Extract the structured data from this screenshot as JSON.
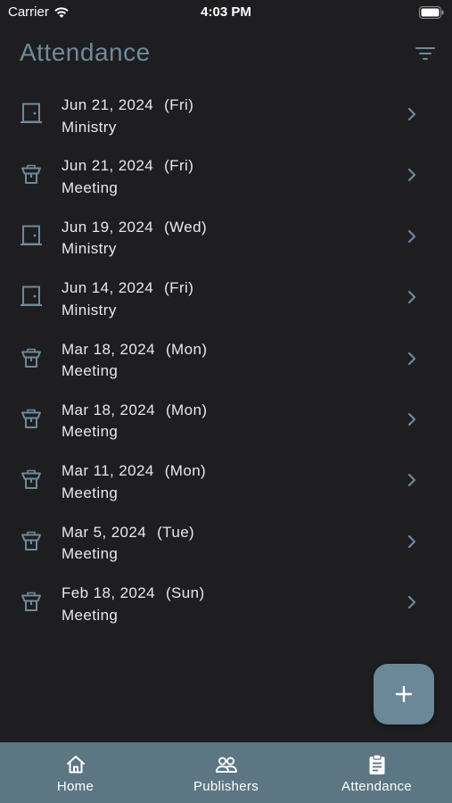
{
  "status_bar": {
    "carrier": "Carrier",
    "time": "4:03 PM"
  },
  "header": {
    "title": "Attendance",
    "filter_icon": "filter-icon"
  },
  "colors": {
    "accent": "#6b8898",
    "title": "#6f8a99",
    "background": "#1e1e20",
    "tabbar": "#5c7683"
  },
  "records": [
    {
      "date": "Jun 21, 2024",
      "day": "(Fri)",
      "type": "Ministry",
      "icon": "door-icon"
    },
    {
      "date": "Jun 21, 2024",
      "day": "(Fri)",
      "type": "Meeting",
      "icon": "lectern-icon"
    },
    {
      "date": "Jun 19, 2024",
      "day": "(Wed)",
      "type": "Ministry",
      "icon": "door-icon"
    },
    {
      "date": "Jun 14, 2024",
      "day": "(Fri)",
      "type": "Ministry",
      "icon": "door-icon"
    },
    {
      "date": "Mar 18, 2024",
      "day": "(Mon)",
      "type": "Meeting",
      "icon": "lectern-icon"
    },
    {
      "date": "Mar 18, 2024",
      "day": "(Mon)",
      "type": "Meeting",
      "icon": "lectern-icon"
    },
    {
      "date": "Mar 11, 2024",
      "day": "(Mon)",
      "type": "Meeting",
      "icon": "lectern-icon"
    },
    {
      "date": "Mar 5, 2024",
      "day": "(Tue)",
      "type": "Meeting",
      "icon": "lectern-icon"
    },
    {
      "date": "Feb 18, 2024",
      "day": "(Sun)",
      "type": "Meeting",
      "icon": "lectern-icon"
    }
  ],
  "fab": {
    "icon": "plus-icon"
  },
  "tabs": [
    {
      "label": "Home",
      "icon": "home-icon"
    },
    {
      "label": "Publishers",
      "icon": "people-icon"
    },
    {
      "label": "Attendance",
      "icon": "clipboard-icon",
      "active": true
    }
  ]
}
